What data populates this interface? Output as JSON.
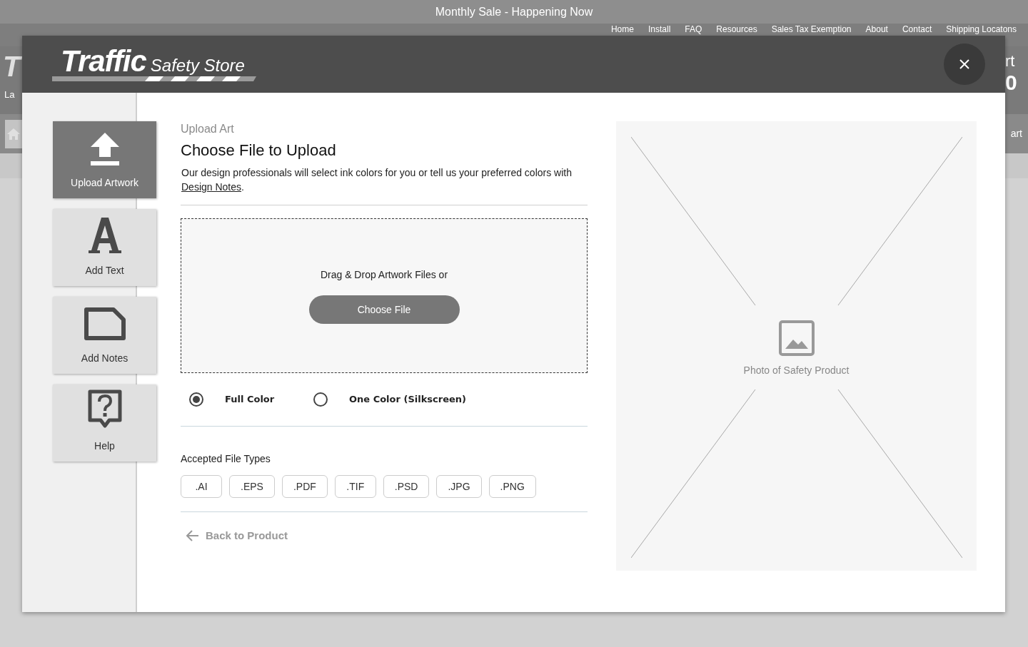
{
  "background_page": {
    "banner": "Monthly Sale - Happening Now",
    "nav": [
      "Home",
      "Install",
      "FAQ",
      "Resources",
      "Sales Tax Exemption",
      "About",
      "Contact",
      "Shipping Locatons"
    ],
    "left_fragments": [
      "T",
      "La"
    ],
    "right_fragments": [
      "rt",
      "0"
    ],
    "cart_button_fragment": "art"
  },
  "modal": {
    "logo": {
      "word": "Traffic",
      "subtitle": "Safety Store"
    },
    "sidebar": [
      {
        "kind": "upload",
        "label": "Upload Artwork",
        "selected": true
      },
      {
        "kind": "text",
        "label": "Add Text",
        "selected": false
      },
      {
        "kind": "notes",
        "label": "Add Notes",
        "selected": false
      },
      {
        "kind": "help",
        "label": "Help",
        "selected": false
      }
    ],
    "eyebrow": "Upload Art",
    "title": "Choose File to Upload",
    "description": {
      "before": "Our design professionals will select ink colors for you or tell us your preferred colors with ",
      "link": "Design Notes",
      "after": "."
    },
    "dropzone": {
      "prompt": "Drag & Drop Artwork Files or",
      "button": "Choose File"
    },
    "color_options": [
      {
        "label": "Full Color",
        "selected": true
      },
      {
        "label": "One Color (Silkscreen)",
        "selected": false
      }
    ],
    "file_types": {
      "label": "Accepted File Types",
      "items": [
        ".AI",
        ".EPS",
        ".PDF",
        ".TIF",
        ".PSD",
        ".JPG",
        ".PNG"
      ]
    },
    "back_link": "Back to Product",
    "preview": {
      "caption": "Photo of Safety Product"
    }
  }
}
